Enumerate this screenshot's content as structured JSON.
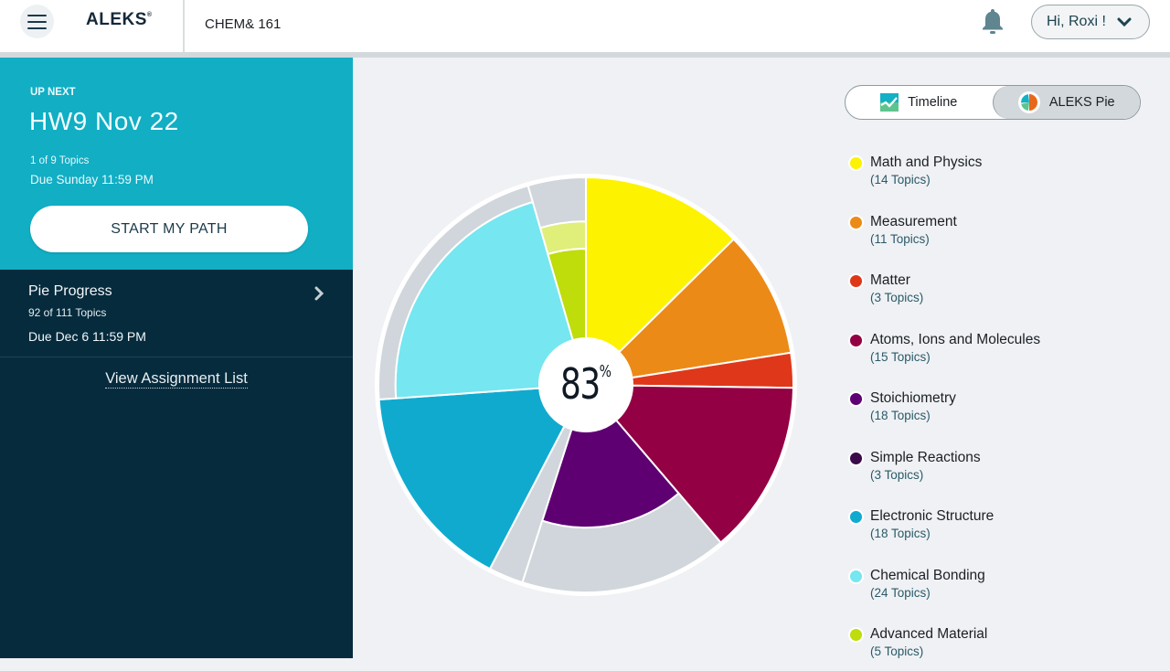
{
  "header": {
    "logo": "ALEKS",
    "logo_mark": "®",
    "course": "CHEM& 161",
    "user_greeting": "Hi, Roxi !",
    "icons": {
      "menu": "hamburger-menu-icon",
      "bell": "bell-icon",
      "chevron": "chevron-down-icon"
    }
  },
  "sidebar": {
    "up_next_label": "UP NEXT",
    "up_next_title": "HW9 Nov 22",
    "up_next_topics": "1 of 9 Topics",
    "up_next_due": "Due Sunday 11:59 PM",
    "start_button": "START MY PATH",
    "pie_progress_title": "Pie Progress",
    "pie_progress_topics": "92 of 111 Topics",
    "pie_progress_due": "Due Dec 6 11:59 PM",
    "view_list_link": "View Assignment List"
  },
  "view_toggle": {
    "options": [
      {
        "label": "Timeline",
        "icon": "timeline-icon",
        "active": false
      },
      {
        "label": "ALEKS Pie",
        "icon": "pie-icon",
        "active": true
      }
    ]
  },
  "colors": {
    "teal": "#11aec4",
    "navy": "#052b3d",
    "unmastered": "#d0d6db"
  },
  "chart_data": {
    "type": "pie",
    "title": "ALEKS Pie",
    "center_label": "83",
    "center_unit": "%",
    "total_topics": 111,
    "mastered_topics": 92,
    "slices": [
      {
        "name": "Math and Physics",
        "topics": 14,
        "mastered": 14,
        "learning": 0,
        "color": "#fdf200",
        "light_color": "#f6f37a",
        "count_label": "(14 Topics)"
      },
      {
        "name": "Measurement",
        "topics": 11,
        "mastered": 11,
        "learning": 0,
        "color": "#ec8a17",
        "light_color": "#f3b26a",
        "count_label": "(11 Topics)"
      },
      {
        "name": "Matter",
        "topics": 3,
        "mastered": 3,
        "learning": 0,
        "color": "#df3719",
        "light_color": "#ea7e6a",
        "count_label": "(3 Topics)"
      },
      {
        "name": "Atoms, Ions and Molecules",
        "topics": 15,
        "mastered": 15,
        "learning": 0,
        "color": "#930043",
        "light_color": "#c0608a",
        "count_label": "(15 Topics)"
      },
      {
        "name": "Stoichiometry",
        "topics": 18,
        "mastered": 8,
        "learning": 0,
        "color": "#5e0072",
        "light_color": "#9a5ca8",
        "count_label": "(18 Topics)"
      },
      {
        "name": "Simple Reactions",
        "topics": 3,
        "mastered": 0,
        "learning": 0,
        "color": "#3b0a4a",
        "light_color": "#7c5a86",
        "count_label": "(3 Topics)"
      },
      {
        "name": "Electronic Structure",
        "topics": 18,
        "mastered": 18,
        "learning": 0,
        "color": "#10aacf",
        "light_color": "#6ccbe2",
        "count_label": "(18 Topics)"
      },
      {
        "name": "Chemical Bonding",
        "topics": 24,
        "mastered": 20,
        "learning": 0,
        "color": "#76e6f0",
        "light_color": "#b4f0f5",
        "count_label": "(24 Topics)"
      },
      {
        "name": "Advanced Material",
        "topics": 5,
        "mastered": 2,
        "learning": 1,
        "color": "#bfdc0b",
        "light_color": "#e0ee7a",
        "count_label": "(5 Topics)"
      }
    ]
  }
}
